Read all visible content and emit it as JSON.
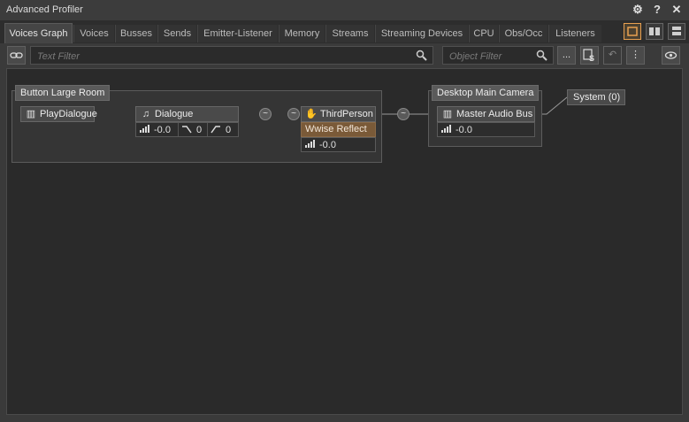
{
  "window": {
    "title": "Advanced Profiler"
  },
  "titlebar_icons": [
    "gear-icon",
    "help-icon",
    "close-icon"
  ],
  "tabs": [
    {
      "label": "Voices Graph",
      "active": true
    },
    {
      "label": "Voices"
    },
    {
      "label": "Busses"
    },
    {
      "label": "Sends"
    },
    {
      "label": "Emitter-Listener"
    },
    {
      "label": "Memory"
    },
    {
      "label": "Streams"
    },
    {
      "label": "Streaming Devices"
    },
    {
      "label": "CPU"
    },
    {
      "label": "Obs/Occ"
    },
    {
      "label": "Listeners"
    }
  ],
  "filters": {
    "text_placeholder": "Text Filter",
    "object_placeholder": "Object Filter",
    "more_label": "..."
  },
  "graph": {
    "groups": {
      "button_room": "Button Large Room",
      "desktop_camera": "Desktop Main Camera"
    },
    "nodes": {
      "play_dialogue": "PlayDialogue",
      "dialogue": "Dialogue",
      "dialogue_volume": "-0.0",
      "dialogue_lpf": "0",
      "dialogue_hpf": "0",
      "third_person": "ThirdPerson",
      "wwise_reflect": "Wwise Reflect",
      "third_person_volume": "-0.0",
      "master_audio_bus": "Master Audio Bus",
      "master_volume": "-0.0",
      "system": "System (0)"
    }
  },
  "colors": {
    "accent": "#e8a050",
    "reflect": "#7a5a38",
    "background": "#2a2a2a"
  }
}
